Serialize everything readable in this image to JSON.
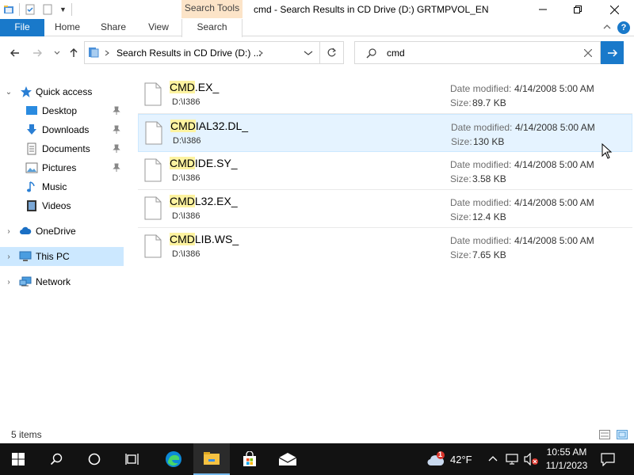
{
  "window": {
    "title": "cmd - Search Results in CD Drive (D:) GRTMPVOL_EN",
    "context_tab_group": "Search Tools"
  },
  "ribbon": {
    "tabs": [
      {
        "label": "File"
      },
      {
        "label": "Home"
      },
      {
        "label": "Share"
      },
      {
        "label": "View"
      },
      {
        "label": "Search"
      }
    ],
    "help_label": "?"
  },
  "address": {
    "path": "Search Results in CD Drive (D:) ...",
    "search_query": "cmd"
  },
  "nav_pane": {
    "items": [
      {
        "label": "Quick access",
        "icon": "star-icon"
      },
      {
        "label": "Desktop",
        "icon": "desktop-icon",
        "pinned": true
      },
      {
        "label": "Downloads",
        "icon": "download-icon",
        "pinned": true
      },
      {
        "label": "Documents",
        "icon": "document-icon",
        "pinned": true
      },
      {
        "label": "Pictures",
        "icon": "pictures-icon",
        "pinned": true
      },
      {
        "label": "Music",
        "icon": "music-icon"
      },
      {
        "label": "Videos",
        "icon": "videos-icon"
      },
      {
        "label": "OneDrive",
        "icon": "cloud-icon"
      },
      {
        "label": "This PC",
        "icon": "computer-icon",
        "selected": true
      },
      {
        "label": "Network",
        "icon": "network-icon"
      }
    ]
  },
  "files": {
    "date_label": "Date modified:",
    "size_label": "Size:",
    "items": [
      {
        "match": "CMD",
        "rest": ".EX_",
        "path": "D:\\I386",
        "date": "4/14/2008 5:00 AM",
        "size": "89.7 KB"
      },
      {
        "match": "CMD",
        "rest": "IAL32.DL_",
        "path": "D:\\I386",
        "date": "4/14/2008 5:00 AM",
        "size": "130 KB"
      },
      {
        "match": "CMD",
        "rest": "IDE.SY_",
        "path": "D:\\I386",
        "date": "4/14/2008 5:00 AM",
        "size": "3.58 KB"
      },
      {
        "match": "CMD",
        "rest": "L32.EX_",
        "path": "D:\\I386",
        "date": "4/14/2008 5:00 AM",
        "size": "12.4 KB"
      },
      {
        "match": "CMD",
        "rest": "LIB.WS_",
        "path": "D:\\I386",
        "date": "4/14/2008 5:00 AM",
        "size": "7.65 KB"
      }
    ]
  },
  "status": {
    "item_count": "5 items"
  },
  "taskbar": {
    "weather_temp": "42°F",
    "weather_badge": "1",
    "time": "10:55 AM",
    "date": "11/1/2023"
  },
  "colors": {
    "accent": "#1979ca",
    "selection": "#cce8ff",
    "hover": "#e5f3ff",
    "match_highlight": "#fdf3a0",
    "context_tab": "#fce4c8"
  }
}
